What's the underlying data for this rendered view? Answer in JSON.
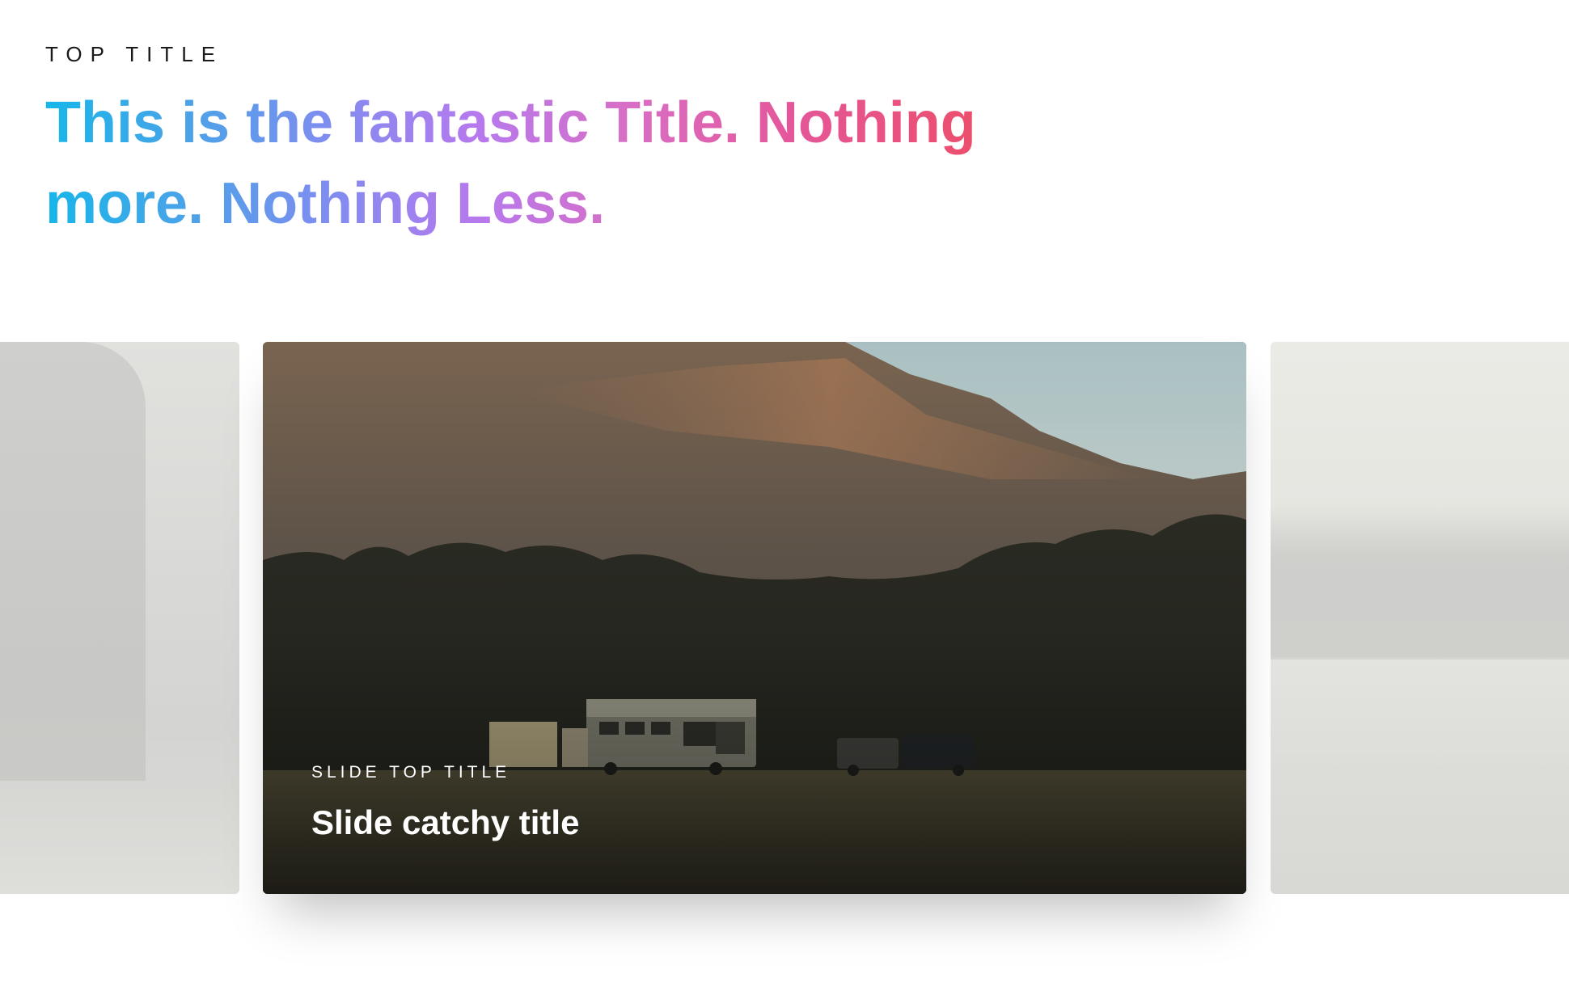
{
  "header": {
    "top_title": "TOP TITLE",
    "title": "This is the fantastic Title. Nothing more. Nothing Less."
  },
  "carousel": {
    "active_slide": {
      "top_title": "SLIDE TOP TITLE",
      "title": "Slide catchy title"
    }
  },
  "colors": {
    "title_gradient": [
      "#17b6ea",
      "#7f8df0",
      "#b679ee",
      "#d86fc6",
      "#ef4b5a"
    ],
    "slide_text": "#ffffff"
  }
}
